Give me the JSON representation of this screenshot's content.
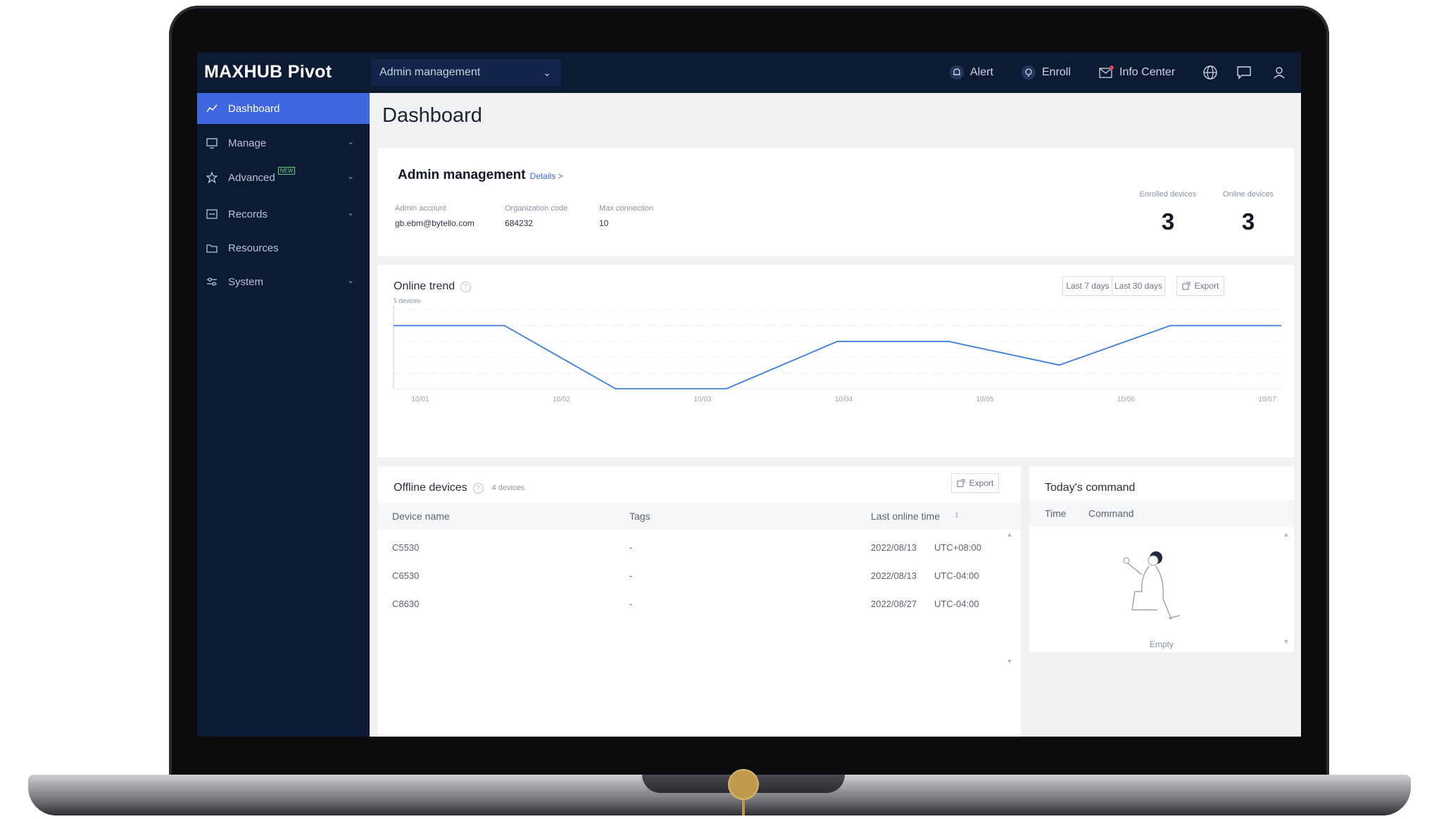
{
  "app": {
    "logo": "MAXHUB Pivot",
    "scope_selector": "Admin management",
    "topbar": {
      "alert": "Alert",
      "enroll": "Enroll",
      "info_center": "Info Center"
    }
  },
  "sidebar": {
    "items": [
      {
        "label": "Dashboard",
        "icon": "chart-line-icon",
        "active": true
      },
      {
        "label": "Manage",
        "icon": "monitor-icon",
        "has_children": true
      },
      {
        "label": "Advanced",
        "icon": "star-icon",
        "has_children": true,
        "badge": "NEW"
      },
      {
        "label": "Records",
        "icon": "list-icon",
        "has_children": true
      },
      {
        "label": "Resources",
        "icon": "folder-icon"
      },
      {
        "label": "System",
        "icon": "sliders-icon",
        "has_children": true
      }
    ]
  },
  "page": {
    "title": "Dashboard"
  },
  "admin_card": {
    "name": "Admin management",
    "details_link": "Details >",
    "fields": [
      {
        "label": "Admin account",
        "value": "gb.ebm@bytello.com"
      },
      {
        "label": "Organization code",
        "value": "684232"
      },
      {
        "label": "Max connection",
        "value": "10"
      }
    ],
    "stats": [
      {
        "label": "Enrolled devices",
        "value": "3"
      },
      {
        "label": "Online devices",
        "value": "3"
      }
    ]
  },
  "trend_card": {
    "title": "Online trend",
    "ranges": [
      "Last 7 days",
      "Last 30 days"
    ],
    "export": "Export",
    "y_unit_label": "5 devices",
    "colors": {
      "line": "#3b7ddd",
      "grid": "#e7eaef"
    }
  },
  "chart_data": {
    "type": "line",
    "title": "Online trend",
    "categories": [
      "10/01",
      "10/02",
      "10/03",
      "10/04",
      "10/05",
      "10/06",
      "10/07"
    ],
    "series": [
      {
        "values": [
          4,
          4,
          0,
          0,
          3,
          3,
          1.5,
          4,
          4
        ]
      }
    ],
    "ylim": [
      0,
      5
    ],
    "grid": true
  },
  "offline_card": {
    "title": "Offline devices",
    "count": "4 devices",
    "export": "Export",
    "columns": [
      "Device name",
      "Tags",
      "Last online time"
    ],
    "rows": [
      {
        "name": "C5530",
        "tags": "-",
        "time": "2022/08/13",
        "tz": "UTC+08:00"
      },
      {
        "name": "C6530",
        "tags": "-",
        "time": "2022/08/13",
        "tz": "UTC-04:00"
      },
      {
        "name": "C8630",
        "tags": "-",
        "time": "2022/08/27",
        "tz": "UTC-04:00"
      }
    ]
  },
  "command_card": {
    "title": "Today's command",
    "columns": [
      "Time",
      "Command"
    ],
    "empty_text": "Empty"
  }
}
